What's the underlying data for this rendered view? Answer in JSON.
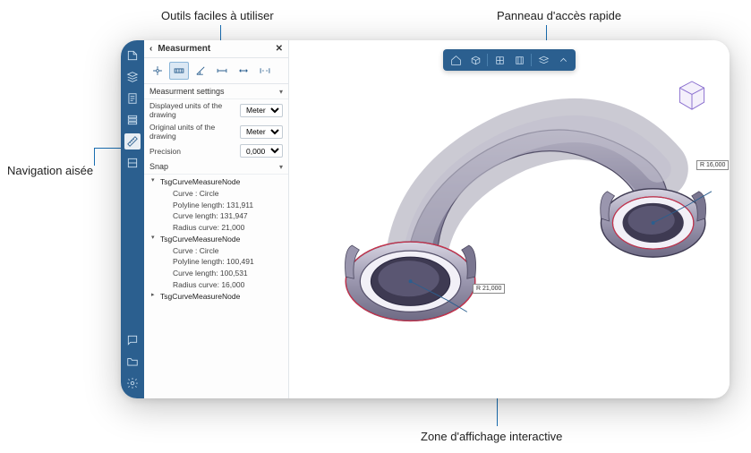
{
  "annotations": {
    "tools": "Outils faciles à utiliser",
    "quickpanel": "Panneau d'accès rapide",
    "nav": "Navigation aisée",
    "viewzone": "Zone d'affichage interactive"
  },
  "panel": {
    "title": "Measurment",
    "toolbar_icons": [
      "measure-point",
      "measure-edge",
      "measure-angle",
      "measure-distance",
      "measure-length",
      "measure-gap"
    ],
    "settings_head": "Measurment settings",
    "rows": [
      {
        "label": "Displayed units of the drawing",
        "value": "Meters",
        "options": [
          "Meters"
        ]
      },
      {
        "label": "Original units of the drawing",
        "value": "Meters",
        "options": [
          "Meters"
        ]
      },
      {
        "label": "Precision",
        "value": "0,000",
        "options": [
          "0,000"
        ]
      }
    ],
    "snap_head": "Snap",
    "tree": [
      {
        "name": "TsgCurveMeasureNode",
        "open": true,
        "children": [
          "Curve : Circle",
          "Polyline length: 131,911",
          "Curve length: 131,947",
          "Radius curve: 21,000"
        ]
      },
      {
        "name": "TsgCurveMeasureNode",
        "open": true,
        "children": [
          "Curve : Circle",
          "Polyline length: 100,491",
          "Curve length: 100,531",
          "Radius curve: 16,000"
        ]
      },
      {
        "name": "TsgCurveMeasureNode",
        "open": false,
        "children": []
      }
    ]
  },
  "quickaccess": {
    "buttons": [
      "home",
      "box",
      "view-iso",
      "view-front",
      "layers",
      "expand"
    ]
  },
  "measure_tags": {
    "left": "R 21,000",
    "right": "R 16,000"
  },
  "colors": {
    "primary": "#2b5f8f",
    "accent": "#1a6fb3"
  }
}
